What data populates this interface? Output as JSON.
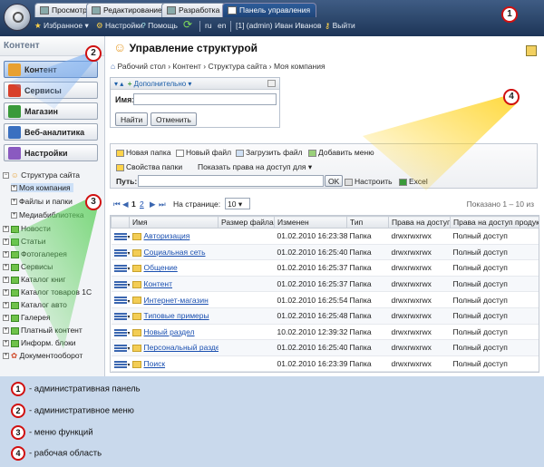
{
  "tabs": [
    {
      "label": "Просмотр"
    },
    {
      "label": "Редактирование"
    },
    {
      "label": "Разработка"
    },
    {
      "label": "Панель управления"
    }
  ],
  "adminbar": {
    "favorites": "Избранное",
    "settings": "Настройки",
    "help": "Помощь",
    "lang_ru": "ru",
    "lang_en": "en",
    "user": "[1] (admin) Иван Иванов",
    "logout": "Выйти"
  },
  "leftpanel": {
    "header": "Контент",
    "menu": [
      {
        "label": "Контент",
        "color": "#e8a030"
      },
      {
        "label": "Сервисы",
        "color": "#d8402a"
      },
      {
        "label": "Магазин",
        "color": "#3a9a3a"
      },
      {
        "label": "Веб-аналитика",
        "color": "#3a70c0"
      },
      {
        "label": "Настройки",
        "color": "#8a5ac0"
      }
    ],
    "tree": [
      "Структура сайта",
      "Моя компания",
      "Файлы и папки",
      "Медиабиблиотека",
      "Новости",
      "Статьи",
      "Фотогалерея",
      "Сервисы",
      "Каталог книг",
      "Каталог товаров 1С",
      "Каталог авто",
      "Галерея",
      "Платный контент",
      "Информ. блоки",
      "Документооборот"
    ]
  },
  "main": {
    "title": "Управление структурой",
    "breadcrumb": "Рабочий стол › Контент › Структура сайта › Моя компания",
    "filter": {
      "more": "Дополнительно",
      "name_label": "Имя:",
      "find": "Найти",
      "cancel": "Отменить"
    },
    "toolbar": {
      "new_folder": "Новая папка",
      "new_file": "Новый файл",
      "upload": "Загрузить файл",
      "add_menu": "Добавить меню",
      "folder_props": "Свойства папки",
      "show_rights": "Показать права на доступ для",
      "path_label": "Путь:",
      "ok": "OK",
      "configure": "Настроить",
      "excel": "Excel"
    },
    "pager": {
      "page1": "1",
      "page2": "2",
      "per_page_label": "На странице:",
      "per_page": "10",
      "shown": "Показано 1 – 10 из"
    },
    "columns": [
      "",
      "Имя",
      "Размер файла",
      "Изменен",
      "Тип",
      "Права на доступ",
      "Права на доступ продук"
    ],
    "rows": [
      {
        "name": "Авторизация",
        "date": "01.02.2010 16:23:38",
        "type": "Папка",
        "rights": "drwxrwxrwx",
        "prod": "Полный доступ"
      },
      {
        "name": "Социальная сеть",
        "date": "01.02.2010 16:25:40",
        "type": "Папка",
        "rights": "drwxrwxrwx",
        "prod": "Полный доступ"
      },
      {
        "name": "Общение",
        "date": "01.02.2010 16:25:37",
        "type": "Папка",
        "rights": "drwxrwxrwx",
        "prod": "Полный доступ"
      },
      {
        "name": "Контент",
        "date": "01.02.2010 16:25:37",
        "type": "Папка",
        "rights": "drwxrwxrwx",
        "prod": "Полный доступ"
      },
      {
        "name": "Интернет-магазин",
        "date": "01.02.2010 16:25:54",
        "type": "Папка",
        "rights": "drwxrwxrwx",
        "prod": "Полный доступ"
      },
      {
        "name": "Типовые примеры",
        "date": "01.02.2010 16:25:48",
        "type": "Папка",
        "rights": "drwxrwxrwx",
        "prod": "Полный доступ"
      },
      {
        "name": "Новый раздел",
        "date": "10.02.2010 12:39:32",
        "type": "Папка",
        "rights": "drwxrwxrwx",
        "prod": "Полный доступ"
      },
      {
        "name": "Персональный раздел",
        "date": "01.02.2010 16:25:40",
        "type": "Папка",
        "rights": "drwxrwxrwx",
        "prod": "Полный доступ"
      },
      {
        "name": "Поиск",
        "date": "01.02.2010 16:23:39",
        "type": "Папка",
        "rights": "drwxrwxrwx",
        "prod": "Полный доступ"
      }
    ]
  },
  "legend": [
    {
      "num": "1",
      "text": "- административная панель"
    },
    {
      "num": "2",
      "text": "- административное меню"
    },
    {
      "num": "3",
      "text": "- меню функций"
    },
    {
      "num": "4",
      "text": "- рабочая область"
    }
  ],
  "callouts": [
    "1",
    "2",
    "3",
    "4"
  ]
}
